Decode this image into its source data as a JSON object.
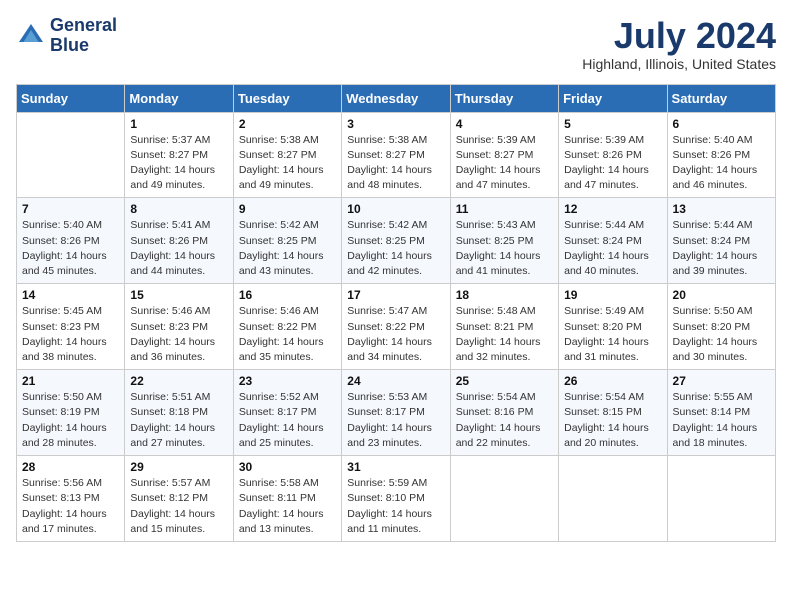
{
  "header": {
    "logo_line1": "General",
    "logo_line2": "Blue",
    "title": "July 2024",
    "location": "Highland, Illinois, United States"
  },
  "weekdays": [
    "Sunday",
    "Monday",
    "Tuesday",
    "Wednesday",
    "Thursday",
    "Friday",
    "Saturday"
  ],
  "weeks": [
    [
      {
        "day": "",
        "info": ""
      },
      {
        "day": "1",
        "info": "Sunrise: 5:37 AM\nSunset: 8:27 PM\nDaylight: 14 hours\nand 49 minutes."
      },
      {
        "day": "2",
        "info": "Sunrise: 5:38 AM\nSunset: 8:27 PM\nDaylight: 14 hours\nand 49 minutes."
      },
      {
        "day": "3",
        "info": "Sunrise: 5:38 AM\nSunset: 8:27 PM\nDaylight: 14 hours\nand 48 minutes."
      },
      {
        "day": "4",
        "info": "Sunrise: 5:39 AM\nSunset: 8:27 PM\nDaylight: 14 hours\nand 47 minutes."
      },
      {
        "day": "5",
        "info": "Sunrise: 5:39 AM\nSunset: 8:26 PM\nDaylight: 14 hours\nand 47 minutes."
      },
      {
        "day": "6",
        "info": "Sunrise: 5:40 AM\nSunset: 8:26 PM\nDaylight: 14 hours\nand 46 minutes."
      }
    ],
    [
      {
        "day": "7",
        "info": "Sunrise: 5:40 AM\nSunset: 8:26 PM\nDaylight: 14 hours\nand 45 minutes."
      },
      {
        "day": "8",
        "info": "Sunrise: 5:41 AM\nSunset: 8:26 PM\nDaylight: 14 hours\nand 44 minutes."
      },
      {
        "day": "9",
        "info": "Sunrise: 5:42 AM\nSunset: 8:25 PM\nDaylight: 14 hours\nand 43 minutes."
      },
      {
        "day": "10",
        "info": "Sunrise: 5:42 AM\nSunset: 8:25 PM\nDaylight: 14 hours\nand 42 minutes."
      },
      {
        "day": "11",
        "info": "Sunrise: 5:43 AM\nSunset: 8:25 PM\nDaylight: 14 hours\nand 41 minutes."
      },
      {
        "day": "12",
        "info": "Sunrise: 5:44 AM\nSunset: 8:24 PM\nDaylight: 14 hours\nand 40 minutes."
      },
      {
        "day": "13",
        "info": "Sunrise: 5:44 AM\nSunset: 8:24 PM\nDaylight: 14 hours\nand 39 minutes."
      }
    ],
    [
      {
        "day": "14",
        "info": "Sunrise: 5:45 AM\nSunset: 8:23 PM\nDaylight: 14 hours\nand 38 minutes."
      },
      {
        "day": "15",
        "info": "Sunrise: 5:46 AM\nSunset: 8:23 PM\nDaylight: 14 hours\nand 36 minutes."
      },
      {
        "day": "16",
        "info": "Sunrise: 5:46 AM\nSunset: 8:22 PM\nDaylight: 14 hours\nand 35 minutes."
      },
      {
        "day": "17",
        "info": "Sunrise: 5:47 AM\nSunset: 8:22 PM\nDaylight: 14 hours\nand 34 minutes."
      },
      {
        "day": "18",
        "info": "Sunrise: 5:48 AM\nSunset: 8:21 PM\nDaylight: 14 hours\nand 32 minutes."
      },
      {
        "day": "19",
        "info": "Sunrise: 5:49 AM\nSunset: 8:20 PM\nDaylight: 14 hours\nand 31 minutes."
      },
      {
        "day": "20",
        "info": "Sunrise: 5:50 AM\nSunset: 8:20 PM\nDaylight: 14 hours\nand 30 minutes."
      }
    ],
    [
      {
        "day": "21",
        "info": "Sunrise: 5:50 AM\nSunset: 8:19 PM\nDaylight: 14 hours\nand 28 minutes."
      },
      {
        "day": "22",
        "info": "Sunrise: 5:51 AM\nSunset: 8:18 PM\nDaylight: 14 hours\nand 27 minutes."
      },
      {
        "day": "23",
        "info": "Sunrise: 5:52 AM\nSunset: 8:17 PM\nDaylight: 14 hours\nand 25 minutes."
      },
      {
        "day": "24",
        "info": "Sunrise: 5:53 AM\nSunset: 8:17 PM\nDaylight: 14 hours\nand 23 minutes."
      },
      {
        "day": "25",
        "info": "Sunrise: 5:54 AM\nSunset: 8:16 PM\nDaylight: 14 hours\nand 22 minutes."
      },
      {
        "day": "26",
        "info": "Sunrise: 5:54 AM\nSunset: 8:15 PM\nDaylight: 14 hours\nand 20 minutes."
      },
      {
        "day": "27",
        "info": "Sunrise: 5:55 AM\nSunset: 8:14 PM\nDaylight: 14 hours\nand 18 minutes."
      }
    ],
    [
      {
        "day": "28",
        "info": "Sunrise: 5:56 AM\nSunset: 8:13 PM\nDaylight: 14 hours\nand 17 minutes."
      },
      {
        "day": "29",
        "info": "Sunrise: 5:57 AM\nSunset: 8:12 PM\nDaylight: 14 hours\nand 15 minutes."
      },
      {
        "day": "30",
        "info": "Sunrise: 5:58 AM\nSunset: 8:11 PM\nDaylight: 14 hours\nand 13 minutes."
      },
      {
        "day": "31",
        "info": "Sunrise: 5:59 AM\nSunset: 8:10 PM\nDaylight: 14 hours\nand 11 minutes."
      },
      {
        "day": "",
        "info": ""
      },
      {
        "day": "",
        "info": ""
      },
      {
        "day": "",
        "info": ""
      }
    ]
  ]
}
